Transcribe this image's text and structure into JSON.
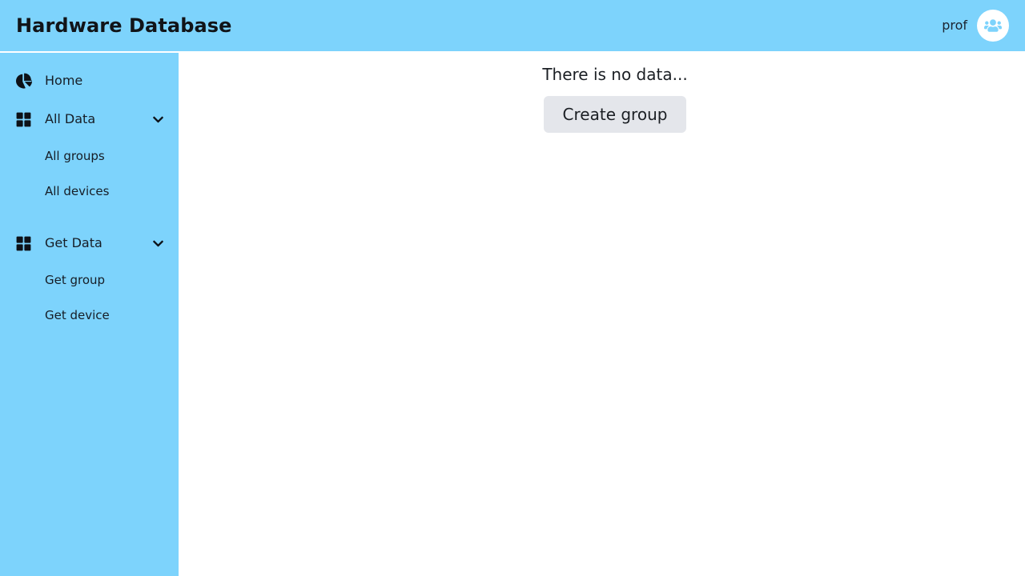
{
  "header": {
    "title": "Hardware Database",
    "user_name": "prof",
    "avatar_icon": "users-icon",
    "background_color": "#7dd3fc"
  },
  "sidebar": {
    "background_color": "#7dd3fc",
    "items": [
      {
        "id": "home",
        "label": "Home",
        "icon": "pie-chart-icon",
        "expandable": false
      },
      {
        "id": "all-data",
        "label": "All Data",
        "icon": "grid-icon",
        "expandable": true,
        "chevron_icon": "chevron-down-icon",
        "children": [
          {
            "id": "all-groups",
            "label": "All groups"
          },
          {
            "id": "all-devices",
            "label": "All devices"
          }
        ]
      },
      {
        "id": "get-data",
        "label": "Get Data",
        "icon": "grid-icon",
        "expandable": true,
        "chevron_icon": "chevron-down-icon",
        "children": [
          {
            "id": "get-group",
            "label": "Get group"
          },
          {
            "id": "get-device",
            "label": "Get device"
          }
        ]
      }
    ]
  },
  "main": {
    "empty_message": "There is no data...",
    "create_button_label": "Create group",
    "button_color": "#e4e6eb"
  }
}
